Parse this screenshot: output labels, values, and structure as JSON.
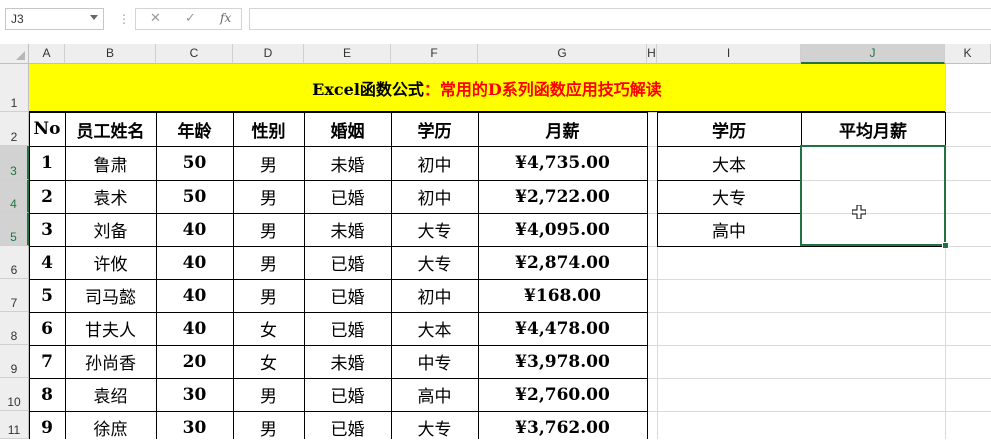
{
  "formula_bar": {
    "name_box": "J3",
    "separator": "⋮",
    "cancel_icon": "✕",
    "enter_icon": "✓",
    "fx_label": "fx",
    "formula": ""
  },
  "columns": [
    "A",
    "B",
    "C",
    "D",
    "E",
    "F",
    "G",
    "H",
    "I",
    "J",
    "K"
  ],
  "rows": [
    "1",
    "2",
    "3",
    "4",
    "5",
    "6",
    "7",
    "8",
    "9",
    "10",
    "11"
  ],
  "title": {
    "part1": "Excel函数公式",
    "part2": "：常用的D系列函数应用技巧解读"
  },
  "main_table": {
    "headers": [
      "No",
      "员工姓名",
      "年龄",
      "性别",
      "婚姻",
      "学历",
      "月薪"
    ],
    "rows": [
      [
        "1",
        "鲁肃",
        "50",
        "男",
        "未婚",
        "初中",
        "¥4,735.00"
      ],
      [
        "2",
        "袁术",
        "50",
        "男",
        "已婚",
        "初中",
        "¥2,722.00"
      ],
      [
        "3",
        "刘备",
        "40",
        "男",
        "未婚",
        "大专",
        "¥4,095.00"
      ],
      [
        "4",
        "许攸",
        "40",
        "男",
        "已婚",
        "大专",
        "¥2,874.00"
      ],
      [
        "5",
        "司马懿",
        "40",
        "男",
        "已婚",
        "初中",
        "¥168.00"
      ],
      [
        "6",
        "甘夫人",
        "40",
        "女",
        "已婚",
        "大本",
        "¥4,478.00"
      ],
      [
        "7",
        "孙尚香",
        "20",
        "女",
        "未婚",
        "中专",
        "¥3,978.00"
      ],
      [
        "8",
        "袁绍",
        "30",
        "男",
        "已婚",
        "高中",
        "¥2,760.00"
      ],
      [
        "9",
        "徐庶",
        "30",
        "男",
        "已婚",
        "大专",
        "¥3,762.00"
      ]
    ]
  },
  "side_table": {
    "headers": [
      "学历",
      "平均月薪"
    ],
    "rows": [
      [
        "大本",
        ""
      ],
      [
        "大专",
        ""
      ],
      [
        "高中",
        ""
      ]
    ]
  },
  "colors": {
    "title_bg": "#ffff00",
    "title_accent": "#ff0000",
    "selection": "#217346"
  }
}
